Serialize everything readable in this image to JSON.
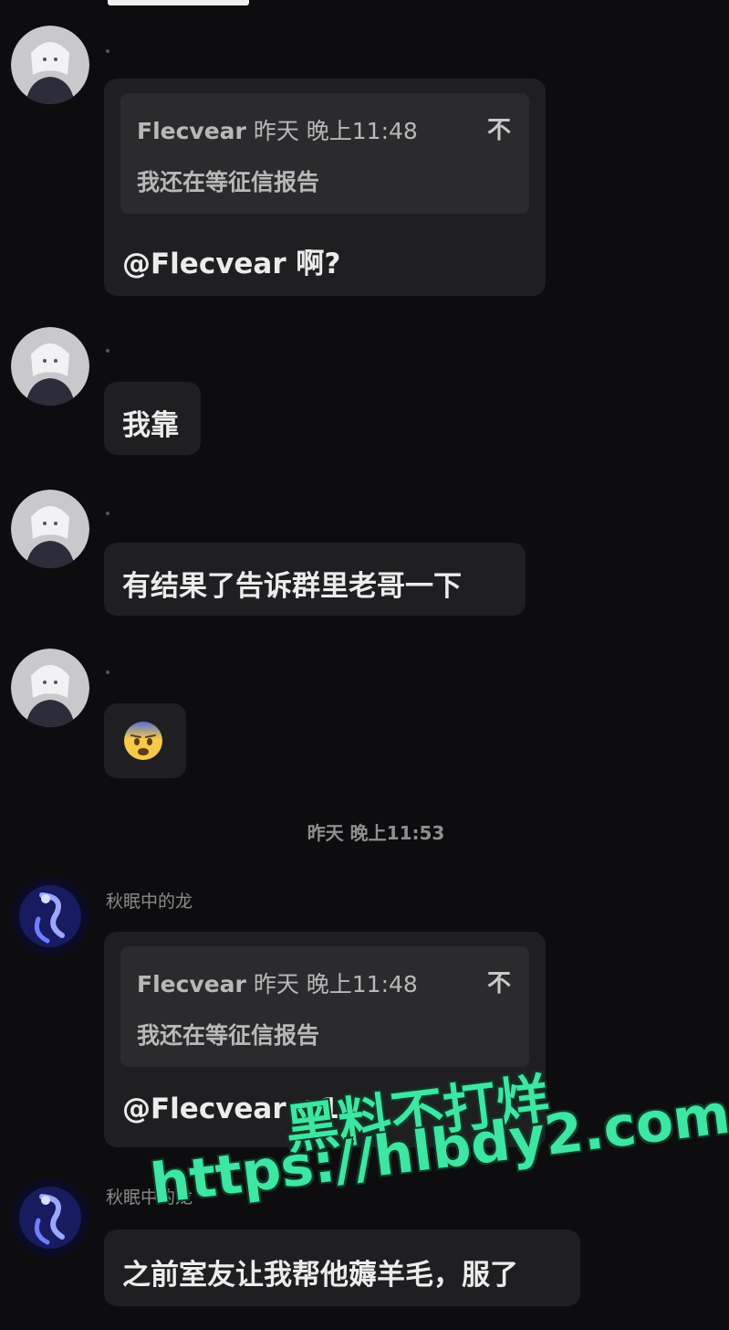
{
  "messages": [
    {
      "sender_name": "",
      "quote": {
        "author": "Flecvear",
        "time": "昨天 晚上11:48",
        "text": "我还在等征信报告",
        "mark": "不"
      },
      "text": "@Flecvear 啊?"
    },
    {
      "sender_name": "",
      "text": "我靠"
    },
    {
      "sender_name": "",
      "text": "有结果了告诉群里老哥一下"
    },
    {
      "sender_name": "",
      "emoji": "fearful-face-emoji"
    },
    {
      "sender_name": "秋眠中的龙",
      "quote": {
        "author": "Flecvear",
        "time": "昨天 晚上11:48",
        "text": "我还在等征信报告",
        "mark": "不"
      },
      "text": "@Flecvear +1"
    },
    {
      "sender_name": "秋眠中的龙",
      "text": "之前室友让我帮他薅羊毛，服了"
    }
  ],
  "timestamp": "昨天 晚上11:53",
  "watermark": {
    "line1": "黑料不打烊",
    "line2": "https://hlbdy2.com"
  },
  "colors": {
    "background": "#0d0d0f",
    "bubble": "#1f1f22",
    "quote": "#2b2b2e",
    "watermark": "#3de6a2"
  }
}
